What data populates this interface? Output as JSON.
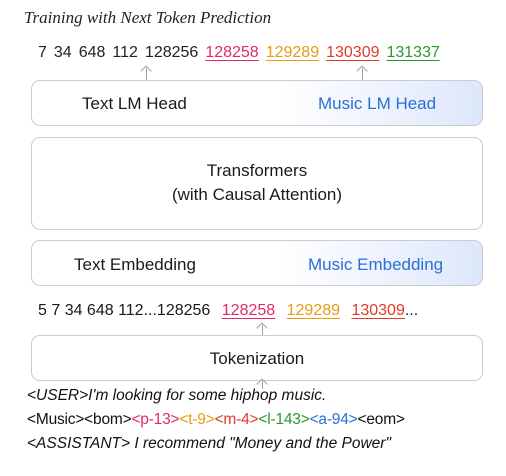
{
  "title": "Training with Next Token Prediction",
  "output_tokens": [
    {
      "text": "7",
      "color": "#222222",
      "underline": false
    },
    {
      "text": "34",
      "color": "#222222",
      "underline": false
    },
    {
      "text": "648",
      "color": "#222222",
      "underline": false
    },
    {
      "text": "112",
      "color": "#222222",
      "underline": false
    },
    {
      "text": "128256",
      "color": "#222222",
      "underline": false
    },
    {
      "text": "128258",
      "color": "#e0286e",
      "underline": true
    },
    {
      "text": "129289",
      "color": "#e89a12",
      "underline": true
    },
    {
      "text": "130309",
      "color": "#e03a2a",
      "underline": true
    },
    {
      "text": "131337",
      "color": "#2a9a2a",
      "underline": true
    }
  ],
  "head": {
    "text_label": "Text LM Head",
    "music_label": "Music LM Head"
  },
  "transformer": {
    "line1": "Transformers",
    "line2": "(with Causal Attention)"
  },
  "embedding": {
    "text_label": "Text Embedding",
    "music_label": "Music Embedding"
  },
  "input_tokens": {
    "plain": "5 7 34 648 112...128256",
    "t1": "128258",
    "t1_color": "#e0286e",
    "t2": "129289",
    "t2_color": "#e89a12",
    "t3": "130309",
    "t3_color": "#e03a2a",
    "suffix": "..."
  },
  "tokenization": {
    "label": "Tokenization"
  },
  "prompt": {
    "line1_tag": "<USER>",
    "line1_text": "I'm looking for some hiphop music.",
    "line2_open": "<Music><bom>",
    "line2_p": "<p-13>",
    "line2_p_color": "#e0286e",
    "line2_t": "<t-9>",
    "line2_t_color": "#e89a12",
    "line2_m": "<m-4>",
    "line2_m_color": "#e03a2a",
    "line2_l": "<l-143>",
    "line2_l_color": "#2a9a2a",
    "line2_a": "<a-94>",
    "line2_a_color": "#2a6fd4",
    "line2_close": "<eom>",
    "line3_tag": "<ASSISTANT>",
    "line3_text": " I recommend \"Money and the Power\""
  },
  "colors": {
    "border": "#c9ccd3",
    "accent_blue": "#2a6fd4",
    "gradient_end": "#dde7fb"
  }
}
